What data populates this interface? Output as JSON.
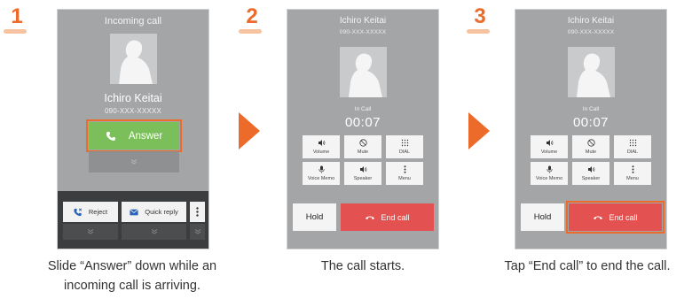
{
  "steps": [
    {
      "number": "1",
      "caption_line1": "Slide “Answer” down while an",
      "caption_line2": "incoming call is arriving.",
      "screen": {
        "title": "Incoming call",
        "caller_name": "Ichiro Keitai",
        "caller_number": "090-XXX-XXXXX",
        "answer_label": "Answer",
        "reject_label": "Reject",
        "quick_reply_label": "Quick reply"
      }
    },
    {
      "number": "2",
      "caption_line1": "The call starts.",
      "screen": {
        "caller_name": "Ichiro Keitai",
        "caller_number": "090-XXX-XXXXX",
        "status": "In Call",
        "timer": "00:07",
        "buttons": [
          "Volume",
          "Mute",
          "DIAL",
          "Voice Memo",
          "Speaker",
          "Menu"
        ],
        "hold_label": "Hold",
        "end_call_label": "End call"
      }
    },
    {
      "number": "3",
      "caption_line1": "Tap “End call” to end the call.",
      "screen": {
        "caller_name": "Ichiro Keitai",
        "caller_number": "090-XXX-XXXXX",
        "status": "In Call",
        "timer": "00:07",
        "buttons": [
          "Volume",
          "Mute",
          "DIAL",
          "Voice Memo",
          "Speaker",
          "Menu"
        ],
        "hold_label": "Hold",
        "end_call_label": "End call"
      }
    }
  ],
  "colors": {
    "accent": "#ec6a2a",
    "answer_green": "#7bbf5a",
    "end_call_red": "#e35250",
    "screen_gray": "#a3a5a7"
  }
}
